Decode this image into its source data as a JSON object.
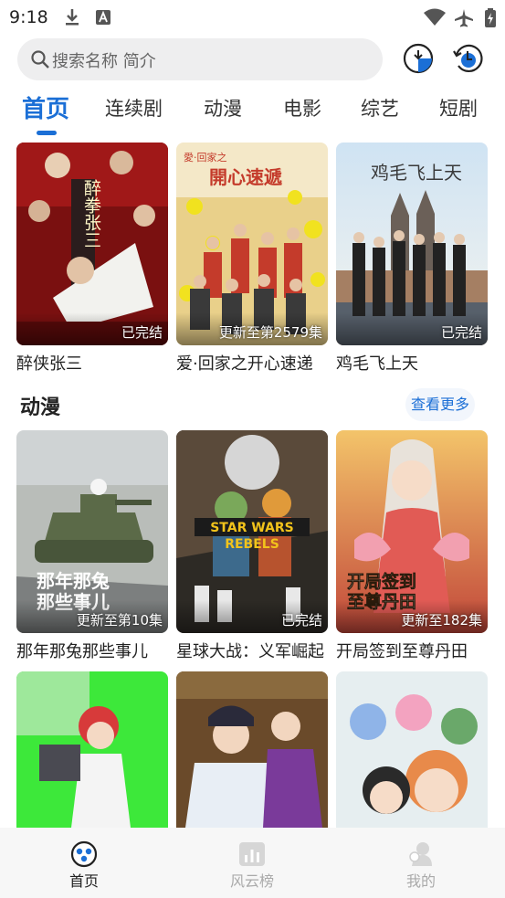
{
  "status_bar": {
    "time": "9:18"
  },
  "search": {
    "placeholder": "搜索名称 简介"
  },
  "tabs": [
    {
      "label": "首页",
      "active": true
    },
    {
      "label": "连续剧",
      "active": false
    },
    {
      "label": "电影",
      "active": false
    },
    {
      "label": "动漫",
      "active": false
    },
    {
      "label": "综艺",
      "active": false
    },
    {
      "label": "短剧",
      "active": false
    }
  ],
  "row1": [
    {
      "title": "醉侠张三",
      "badge": "已完结"
    },
    {
      "title": "爱·回家之开心速递",
      "badge": "更新至第2579集"
    },
    {
      "title": "鸡毛飞上天",
      "badge": "已完结"
    }
  ],
  "section": {
    "title": "动漫",
    "more": "查看更多"
  },
  "row2": [
    {
      "title": "那年那兔那些事儿",
      "badge": "更新至第10集"
    },
    {
      "title": "星球大战：义军崛起",
      "badge": "已完结"
    },
    {
      "title": "开局签到至尊丹田",
      "badge": "更新至182集"
    }
  ],
  "posters": {
    "p1": {
      "text": "醉拳张三"
    },
    "p2": {
      "text": "開心速遞",
      "text2": "愛·回家之"
    },
    "p3": {
      "text": "鸡毛飞上天"
    },
    "p4": {
      "text": "那年那兔",
      "text2": "那些事儿"
    },
    "p5": {
      "text": "STAR WARS",
      "text2": "REBELS"
    },
    "p6": {
      "text": "开局签到",
      "text2": "至尊丹田"
    }
  },
  "bottom_nav": [
    {
      "label": "首页",
      "icon": "home-icon",
      "active": true
    },
    {
      "label": "风云榜",
      "icon": "chart-icon",
      "active": false
    },
    {
      "label": "我的",
      "icon": "user-icon",
      "active": false
    }
  ],
  "colors": {
    "accent": "#1b6fd6",
    "inactive": "#aaaaaa"
  }
}
